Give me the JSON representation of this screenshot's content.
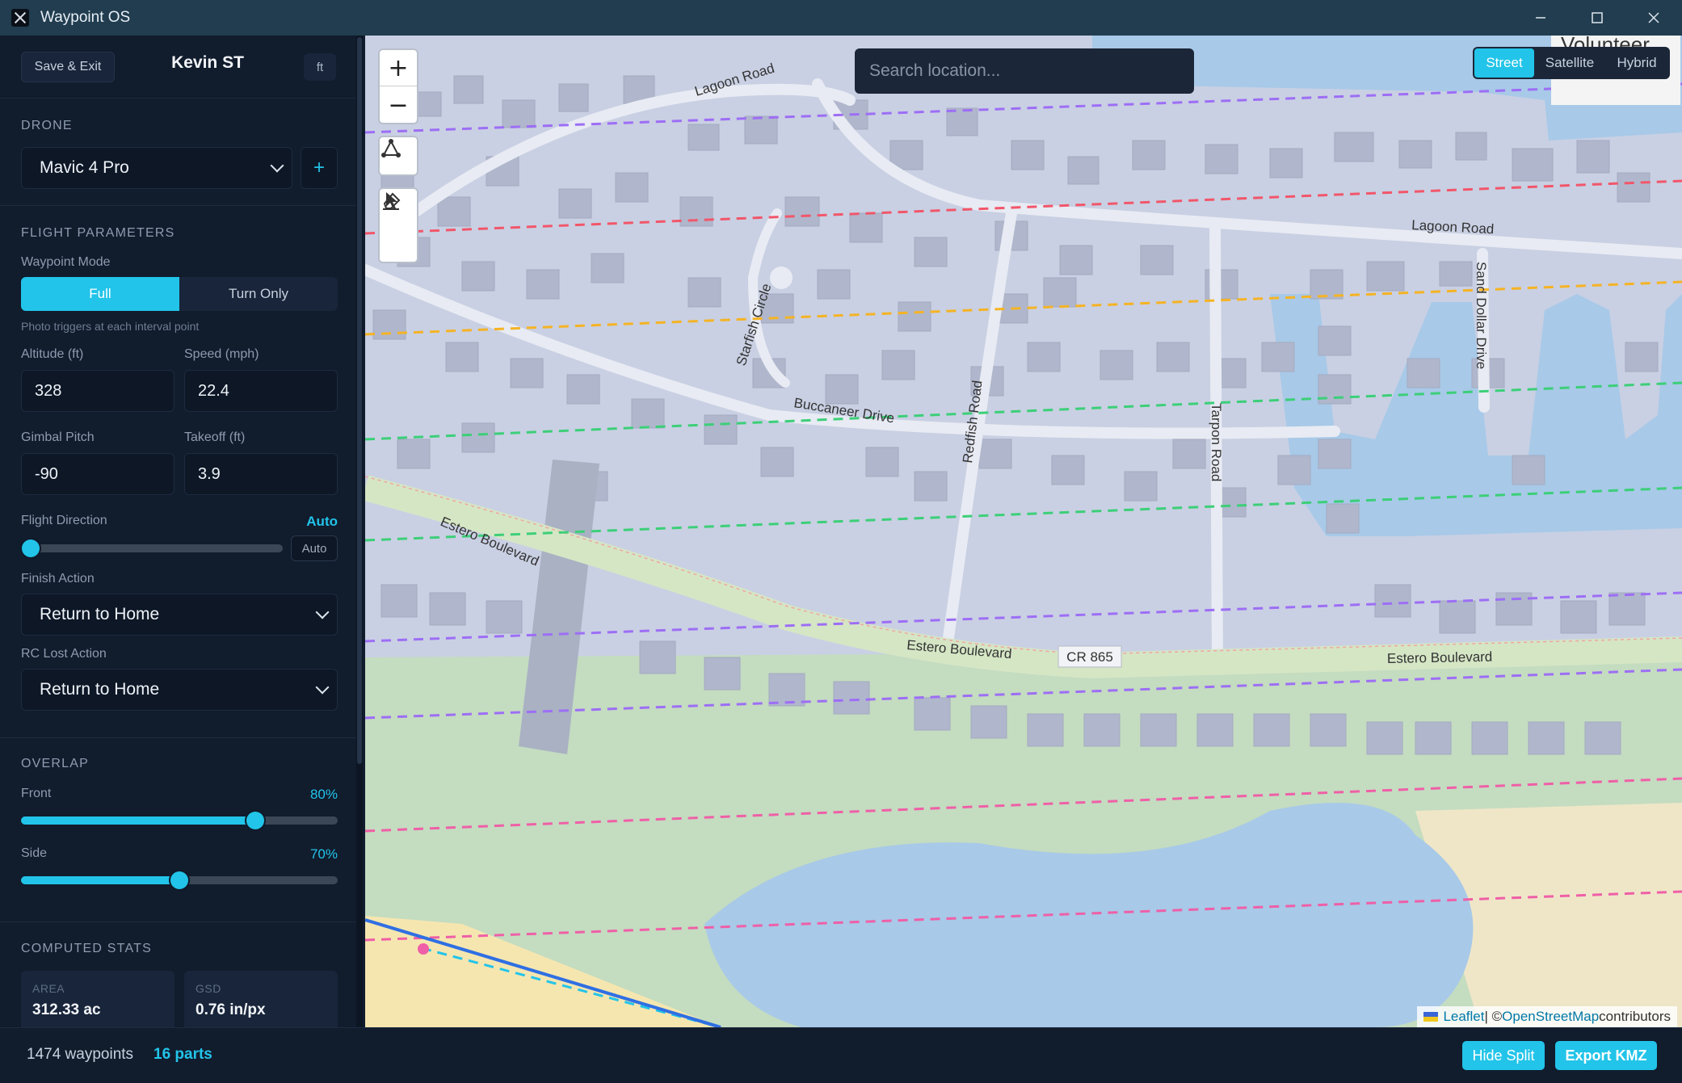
{
  "window": {
    "title": "Waypoint OS"
  },
  "sidebar": {
    "save_exit_label": "Save & Exit",
    "user_name": "Kevin ST",
    "unit_label": "ft",
    "drone": {
      "section_label": "Drone",
      "selected": "Mavic 4 Pro",
      "add_label": "+"
    },
    "flight": {
      "section_label": "Flight Parameters",
      "mode_label": "Waypoint Mode",
      "mode_full": "Full",
      "mode_turn": "Turn Only",
      "mode_hint": "Photo triggers at each interval point",
      "altitude_label": "Altitude (ft)",
      "altitude_value": "328",
      "speed_label": "Speed (mph)",
      "speed_value": "22.4",
      "gimbal_label": "Gimbal Pitch",
      "gimbal_value": "-90",
      "takeoff_label": "Takeoff (ft)",
      "takeoff_value": "3.9",
      "direction_label": "Flight Direction",
      "direction_value": "Auto",
      "direction_chip": "Auto",
      "direction_fraction": 0.0,
      "finish_label": "Finish Action",
      "finish_value": "Return to Home",
      "rc_lost_label": "RC Lost Action",
      "rc_lost_value": "Return to Home"
    },
    "overlap": {
      "section_label": "Overlap",
      "front_label": "Front",
      "front_value": "80%",
      "front_fraction": 0.74,
      "side_label": "Side",
      "side_value": "70%",
      "side_fraction": 0.5
    },
    "stats": {
      "section_label": "Computed Stats",
      "area_label": "Area",
      "area_value": "312.33 ac",
      "gsd_label": "GSD",
      "gsd_value": "0.76 in/px"
    }
  },
  "footer": {
    "waypoints": "1474 waypoints",
    "parts": "16 parts",
    "hide_split": "Hide Split",
    "export": "Export KMZ"
  },
  "map": {
    "search_placeholder": "Search location...",
    "layers": [
      "Street",
      "Satellite",
      "Hybrid"
    ],
    "active_layer": "Street",
    "zoom_in": "+",
    "zoom_out": "−",
    "street_labels": {
      "lagoon_1": "Lagoon Road",
      "lagoon_2": "Lagoon Road",
      "starfish": "Starfish Circle",
      "buccaneer": "Buccaneer Drive",
      "redfish": "Redfish Road",
      "tarpon": "Tarpon Road",
      "sand_dollar": "Sand Dollar Drive",
      "estero_1": "Estero Boulevard",
      "estero_2": "Estero Boulevard",
      "estero_3": "Estero Boulevard",
      "cr865": "CR 865",
      "volunteer": "Volunteer"
    },
    "attribution": {
      "leaflet": "Leaflet",
      "sep": " | © ",
      "osm": "OpenStreetMap",
      "suffix": " contributors"
    },
    "colors": {
      "accent": "#22c4e9",
      "line_purple": "#9d6ef5",
      "line_red": "#f2566a",
      "line_orange": "#f5b324",
      "line_green": "#3ccf78",
      "line_pink": "#ef5fa7",
      "boundary_blue": "#2f6fe3"
    }
  }
}
